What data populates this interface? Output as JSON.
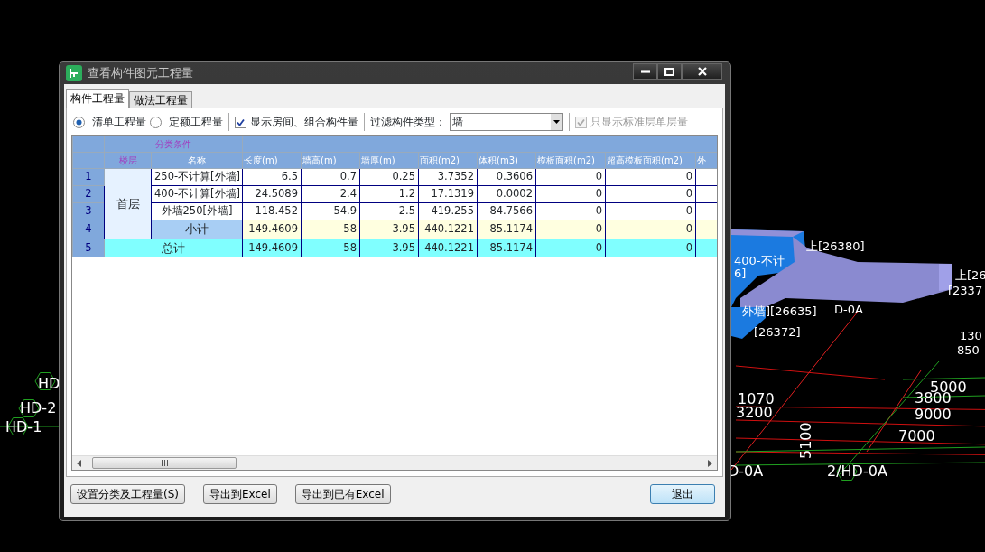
{
  "window": {
    "title": "查看构件图元工程量"
  },
  "tabs": [
    {
      "label": "构件工程量",
      "selected": true
    },
    {
      "label": "做法工程量",
      "selected": false
    }
  ],
  "quantity_mode": [
    {
      "label": "清单工程量",
      "selected": true
    },
    {
      "label": "定额工程量",
      "selected": false
    }
  ],
  "show_rooms": {
    "label": "显示房间、组合构件量",
    "checked": true
  },
  "filter": {
    "label": "过滤构件类型：",
    "value": "墙"
  },
  "standard_floor_only": {
    "label": "只显示标准层单层量",
    "checked": true,
    "disabled": true
  },
  "table": {
    "group_header": "分类条件",
    "columns": [
      "楼层",
      "名称",
      "长度(m)",
      "墙高(m)",
      "墙厚(m)",
      "面积(m2)",
      "体积(m3)",
      "模板面积(m2)",
      "超高模板面积(m2)",
      "外"
    ],
    "groups": [
      {
        "floor": "首层",
        "items": [
          {
            "num": "1",
            "name": "250-不计算[外墙]",
            "values": [
              "6.5",
              "0.7",
              "0.25",
              "3.7352",
              "0.3606",
              "0",
              "0"
            ]
          },
          {
            "num": "2",
            "name": "400-不计算[外墙]",
            "values": [
              "24.5089",
              "2.4",
              "1.2",
              "17.1319",
              "0.0002",
              "0",
              "0"
            ]
          },
          {
            "num": "3",
            "name": "外墙250[外墙]",
            "values": [
              "118.452",
              "54.9",
              "2.5",
              "419.255",
              "84.7566",
              "0",
              "0"
            ]
          }
        ],
        "subtotal": {
          "num": "4",
          "label": "小计",
          "values": [
            "149.4609",
            "58",
            "3.95",
            "440.1221",
            "85.1174",
            "0",
            "0"
          ]
        }
      }
    ],
    "total": {
      "num": "5",
      "label": "总计",
      "values": [
        "149.4609",
        "58",
        "3.95",
        "440.1221",
        "85.1174",
        "0",
        "0"
      ]
    }
  },
  "buttons": [
    {
      "label": "设置分类及工程量(S)",
      "default": false
    },
    {
      "label": "导出到Excel",
      "default": false
    },
    {
      "label": "导出到已有Excel",
      "default": false
    },
    {
      "label": "退出",
      "default": true
    }
  ],
  "canvas": {
    "labels": [
      "HD",
      "HD-2",
      "HD-1",
      "上[26380]",
      "400-不计",
      "6]",
      "上[26",
      "[2337",
      "外墙][26635]",
      "[26372]",
      "D-0A",
      "130",
      "850",
      "5000",
      "3800",
      "9000",
      "7000",
      "1070",
      "3200",
      "5100",
      "D-0A",
      "2/HD-0A"
    ]
  }
}
